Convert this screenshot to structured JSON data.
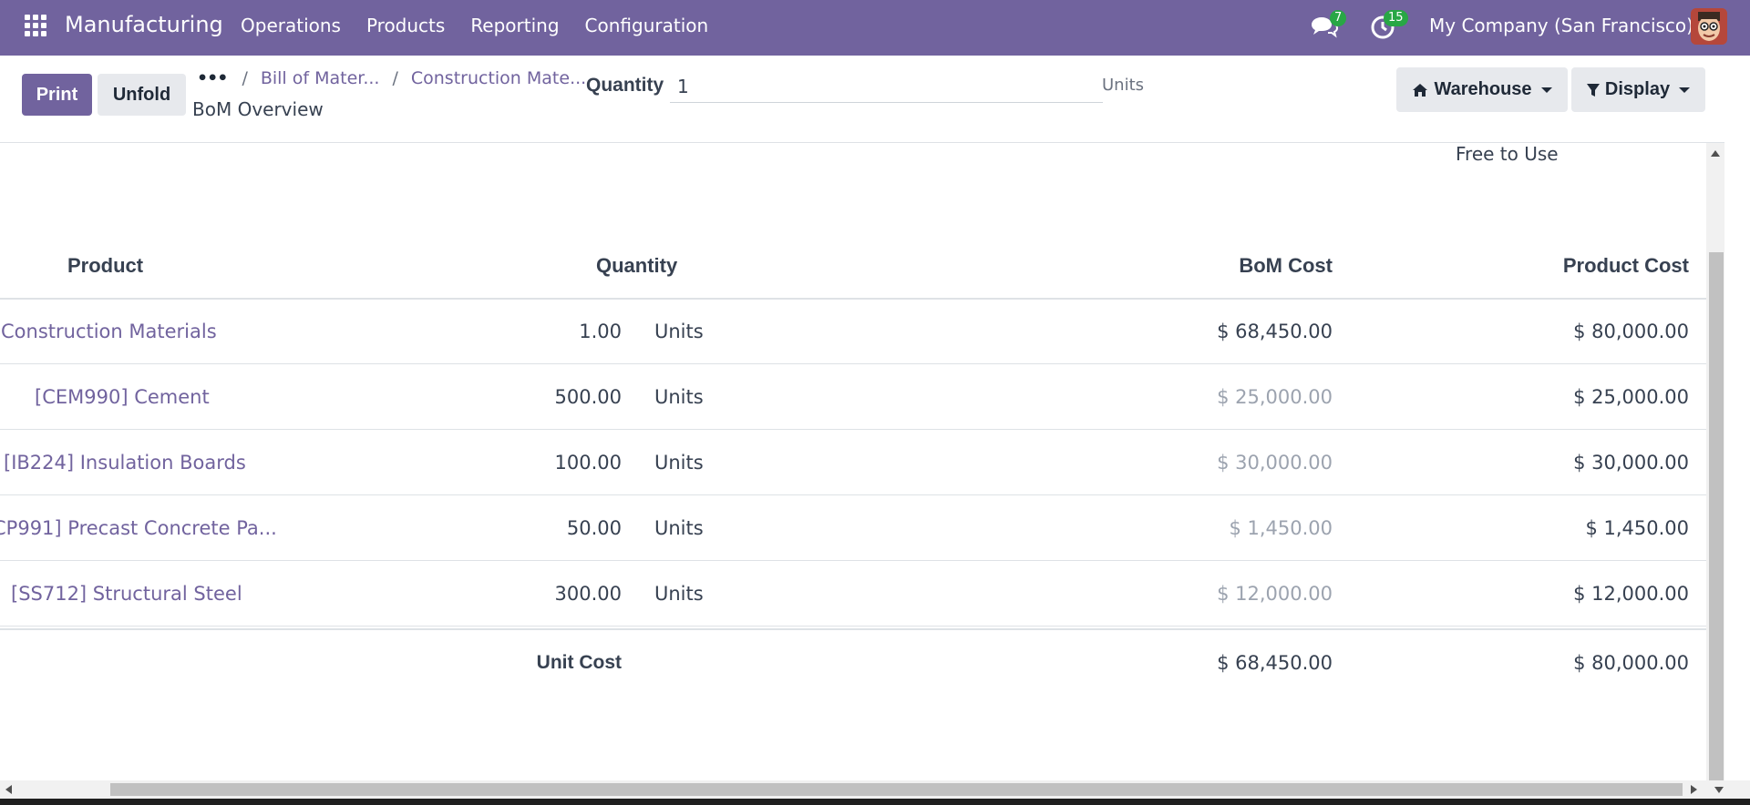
{
  "navbar": {
    "brand": "Manufacturing",
    "menu": [
      "Operations",
      "Products",
      "Reporting",
      "Configuration"
    ],
    "messages_count": "7",
    "activities_count": "15",
    "company": "My Company (San Francisco)",
    "color": "#71639e"
  },
  "control": {
    "print_label": "Print",
    "unfold_label": "Unfold",
    "breadcrumb_dots": "•••",
    "breadcrumb": [
      "Bill of Mater...",
      "Construction Mate..."
    ],
    "subtitle": "BoM Overview",
    "quantity_label": "Quantity",
    "quantity_value": "1",
    "quantity_unit": "Units",
    "warehouse_label": "Warehouse",
    "display_label": "Display"
  },
  "report": {
    "free_to_use": "Free to Use",
    "headers": {
      "product": "Product",
      "quantity": "Quantity",
      "bom_cost": "BoM Cost",
      "product_cost": "Product Cost"
    },
    "rows": [
      {
        "product": "Construction Materials",
        "qty": "1.00",
        "unit": "Units",
        "bom_cost": "$ 68,450.00",
        "product_cost": "$ 80,000.00",
        "muted": false
      },
      {
        "product": "[CEM990] Cement",
        "qty": "500.00",
        "unit": "Units",
        "bom_cost": "$ 25,000.00",
        "product_cost": "$ 25,000.00",
        "muted": true
      },
      {
        "product": "[IB224] Insulation Boards",
        "qty": "100.00",
        "unit": "Units",
        "bom_cost": "$ 30,000.00",
        "product_cost": "$ 30,000.00",
        "muted": true
      },
      {
        "product": "CP991] Precast Concrete Pa...",
        "qty": "50.00",
        "unit": "Units",
        "bom_cost": "$ 1,450.00",
        "product_cost": "$ 1,450.00",
        "muted": true
      },
      {
        "product": "[SS712] Structural Steel",
        "qty": "300.00",
        "unit": "Units",
        "bom_cost": "$ 12,000.00",
        "product_cost": "$ 12,000.00",
        "muted": true
      }
    ],
    "total": {
      "label": "Unit Cost",
      "bom_cost": "$ 68,450.00",
      "product_cost": "$ 80,000.00"
    }
  }
}
